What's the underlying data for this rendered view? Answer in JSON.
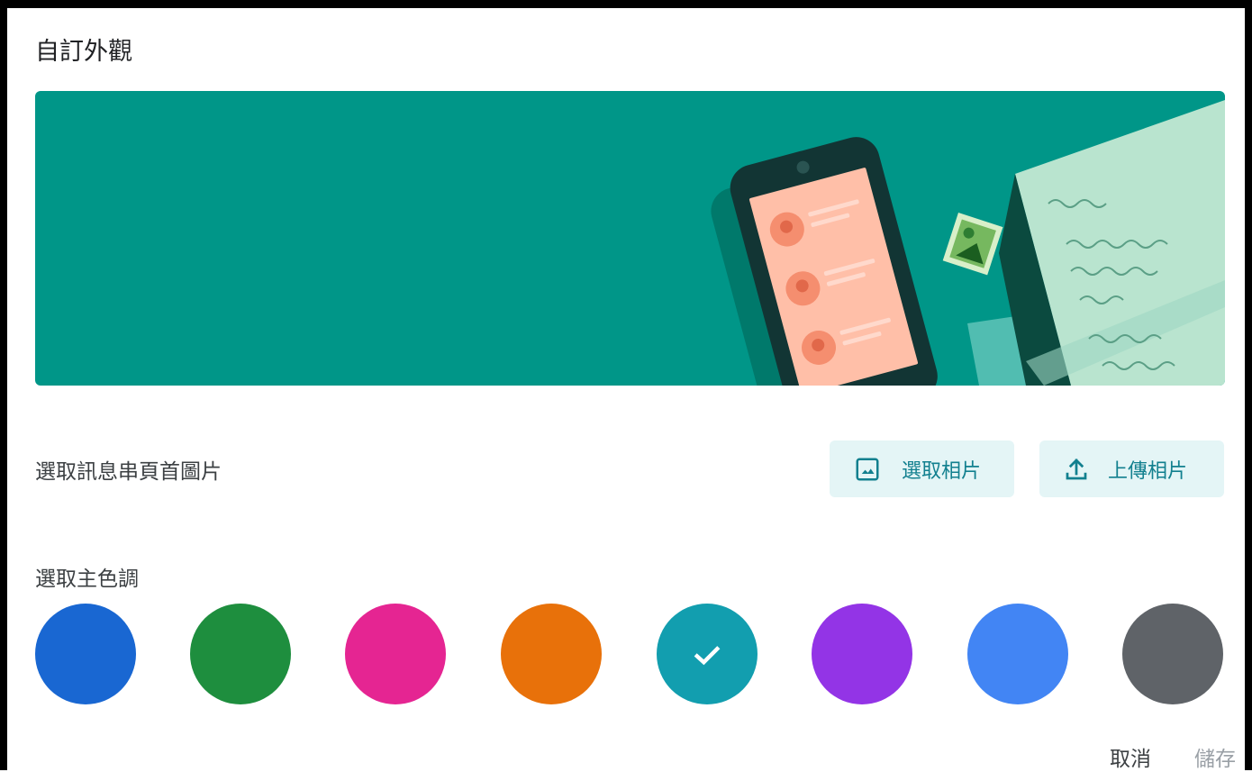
{
  "dialog": {
    "title": "自訂外觀",
    "header_section": {
      "label": "選取訊息串頁首圖片",
      "select_photo_label": "選取相片",
      "upload_photo_label": "上傳相片",
      "select_icon": "image-icon",
      "upload_icon": "upload-icon"
    },
    "theme_section": {
      "label": "選取主色調",
      "selected_index": 4,
      "colors": [
        "#1967d2",
        "#1e8e3e",
        "#e52592",
        "#e8710a",
        "#129eaf",
        "#9334e6",
        "#4285f4",
        "#5f6368"
      ]
    },
    "footer": {
      "cancel_label": "取消",
      "save_label": "儲存"
    }
  },
  "banner": {
    "background": "#009688"
  }
}
